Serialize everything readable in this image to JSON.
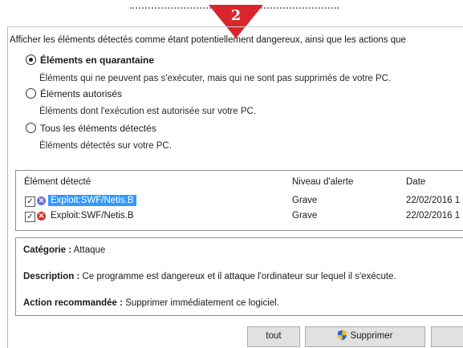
{
  "step_badge": {
    "number": "2",
    "color": "#d9262c"
  },
  "intro_text": "Afficher les éléments détectés comme étant potentiellement dangereux, ainsi que les actions que",
  "filter_options": [
    {
      "label": "Éléments en quarantaine",
      "description": "Éléments qui ne peuvent pas s'exécuter, mais qui ne sont pas supprimés de votre PC.",
      "selected": true
    },
    {
      "label": "Éléments autorisés",
      "description": "Éléments dont l'exécution est autorisée sur votre PC.",
      "selected": false
    },
    {
      "label": "Tous les éléments détectés",
      "description": "Éléments détectés sur votre PC.",
      "selected": false
    }
  ],
  "table": {
    "columns": [
      "Élément détecté",
      "Niveau d'alerte",
      "Date"
    ],
    "rows": [
      {
        "name": "Exploit:SWF/Netis.B",
        "level": "Grave",
        "date": "22/02/2016 1",
        "checked": true,
        "selected": true,
        "icon": "quarantine-icon"
      },
      {
        "name": "Exploit:SWF/Netis.B",
        "level": "Grave",
        "date": "22/02/2016 1",
        "checked": true,
        "selected": false,
        "icon": "threat-icon"
      }
    ]
  },
  "details": {
    "category_label": "Catégorie :",
    "category_value": "Attaque",
    "description_label": "Description :",
    "description_value": "Ce programme est dangereux et il attaque l'ordinateur sur lequel il s'exécute.",
    "action_label": "Action recommandée :",
    "action_value": "Supprimer immédiatement ce logiciel."
  },
  "buttons": {
    "all_label": "tout",
    "delete_label": "Supprimer"
  },
  "colors": {
    "selection": "#3399ff",
    "threat_red": "#d7322b",
    "quarantine_blue": "#6a6fd0"
  }
}
